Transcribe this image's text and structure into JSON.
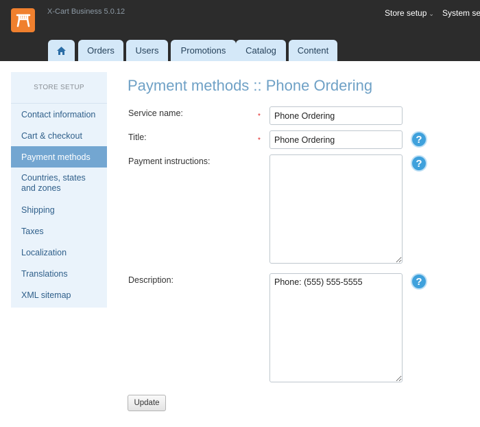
{
  "header": {
    "version": "X-Cart Business 5.0.12",
    "top_menus": [
      {
        "label": "Store setup",
        "icon": "chevron-down"
      },
      {
        "label": "System sett",
        "icon": "chevron-down"
      }
    ],
    "tabs": [
      {
        "label": "",
        "icon": "home"
      },
      {
        "label": "Orders"
      },
      {
        "label": "Users"
      },
      {
        "label": "Promotions"
      },
      {
        "label": "Catalog"
      },
      {
        "label": "Content"
      }
    ]
  },
  "sidebar": {
    "header": "STORE SETUP",
    "items": [
      {
        "label": "Contact information"
      },
      {
        "label": "Cart & checkout"
      },
      {
        "label": "Payment methods",
        "active": true
      },
      {
        "label": "Countries, states\nand zones"
      },
      {
        "label": "Shipping"
      },
      {
        "label": "Taxes"
      },
      {
        "label": "Localization"
      },
      {
        "label": "Translations"
      },
      {
        "label": "XML sitemap"
      }
    ]
  },
  "main": {
    "title": "Payment methods :: Phone Ordering",
    "form": {
      "service_name": {
        "label": "Service name:",
        "value": "Phone Ordering",
        "required": "*"
      },
      "title": {
        "label": "Title:",
        "value": "Phone Ordering",
        "required": "*",
        "help": "?"
      },
      "payment_instructions": {
        "label": "Payment instructions:",
        "value": "",
        "help": "?"
      },
      "description": {
        "label": "Description:",
        "value": "Phone: (555) 555-5555",
        "help": "?"
      }
    },
    "update_label": "Update"
  },
  "colors": {
    "topbar": "#2c2c2c",
    "logo": "#f0802e",
    "tab": "#d4e8f8",
    "sidebar": "#eaf3fb",
    "sidebar_active": "#73a6d1",
    "title": "#6fa1c6",
    "help": "#3fa1dc",
    "required": "#e02020"
  }
}
